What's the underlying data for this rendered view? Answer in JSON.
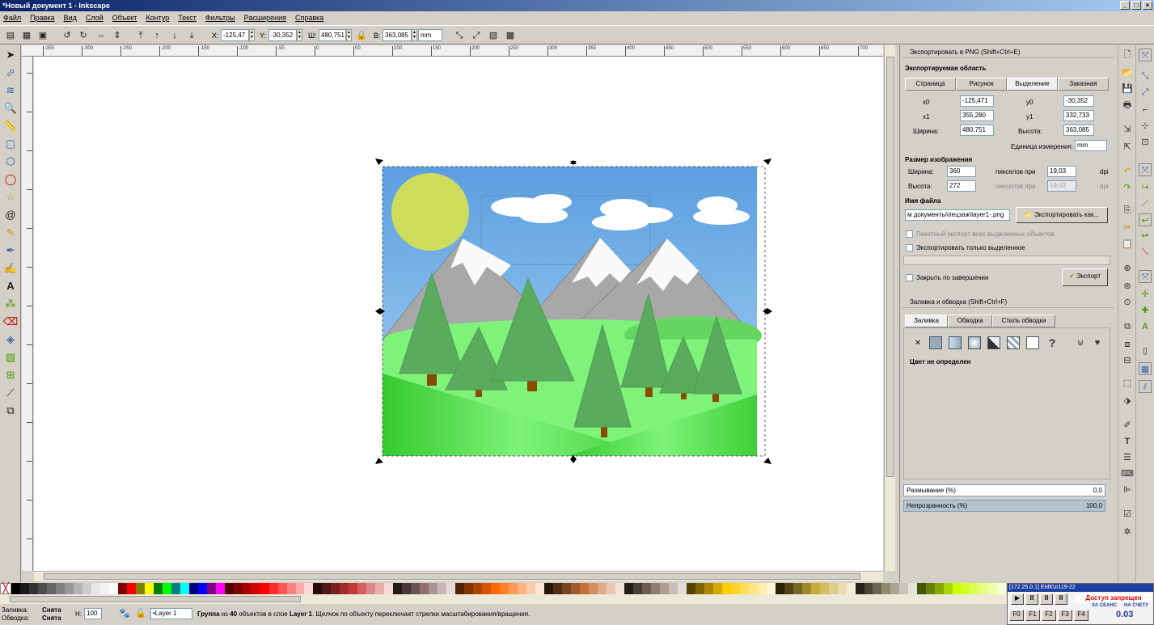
{
  "title": "*Новый документ 1 - Inkscape",
  "window_buttons": [
    "_",
    "□",
    "×"
  ],
  "menu": [
    "Файл",
    "Правка",
    "Вид",
    "Слой",
    "Объект",
    "Контур",
    "Текст",
    "Фильтры",
    "Расширения",
    "Справка"
  ],
  "controls": {
    "x_label": "X:",
    "x": "-125,47",
    "y_label": "Y:",
    "y": "-30,352",
    "w_label": "Ш:",
    "w": "480,751",
    "h_label": "В:",
    "h": "363,085",
    "unit": "mm"
  },
  "ruler_ticks": [
    "-350",
    "-300",
    "-250",
    "-200",
    "-150",
    "-100",
    "-50",
    "0",
    "50",
    "100",
    "150",
    "200",
    "250",
    "300",
    "350",
    "400",
    "450",
    "500",
    "550",
    "600",
    "650",
    "700",
    "750"
  ],
  "export": {
    "title": "Экспортировать в PNG (Shift+Ctrl+E)",
    "area_heading": "Экспортируемая область",
    "tabs": [
      "Страница",
      "Рисунок",
      "Выделение",
      "Заказная"
    ],
    "x0_label": "x0",
    "x0": "-125,471",
    "y0_label": "y0",
    "y0": "-30,352",
    "x1_label": "x1",
    "x1": "355,280",
    "y1_label": "y1",
    "y1": "332,733",
    "width_label": "Ширина:",
    "width": "480,751",
    "height_label": "Высота:",
    "height": "363,085",
    "unit_label": "Единица измерения:",
    "unit": "mm",
    "size_heading": "Размер изображения",
    "px_width_label": "Ширина:",
    "px_width": "360",
    "ppi_label": "пикселов при",
    "dpi": "19,03",
    "dpi_unit": "dpi",
    "px_height_label": "Высота:",
    "px_height": "272",
    "dpi2": "19,03",
    "file_heading": "Имя файла",
    "filename": "м документы\\пецзаж\\layer1-.png",
    "export_as": "Экспортировать как...",
    "batch": "Пакетный экспорт всех выделенных объектов",
    "only_selected": "Экспортировать только выделенное",
    "close_when_done": "Закрыть по завершении",
    "export_btn": "Экспорт"
  },
  "fill": {
    "title": "Заливка и обводка (Shift+Ctrl+F)",
    "tabs": [
      "Заливка",
      "Обводка",
      "Стиль обводки"
    ],
    "undefined": "Цвет не определен",
    "blur_label": "Размывание (%)",
    "blur": "0,0",
    "opacity_label": "Непрозрачность (%)",
    "opacity": "100,0"
  },
  "palette": [
    "#000000",
    "#1a1a1a",
    "#333333",
    "#4d4d4d",
    "#666666",
    "#808080",
    "#999999",
    "#b3b3b3",
    "#cccccc",
    "#e6e6e6",
    "#f2f2f2",
    "#ffffff",
    "#800000",
    "#ff0000",
    "#808000",
    "#ffff00",
    "#008000",
    "#00ff00",
    "#008080",
    "#00ffff",
    "#000080",
    "#0000ff",
    "#800080",
    "#ff00ff",
    "#550000",
    "#800000",
    "#aa0000",
    "#d40000",
    "#ff0000",
    "#ff2a2a",
    "#ff5555",
    "#ff8080",
    "#ffaaaa",
    "#ffd5d5",
    "#280b0b",
    "#501616",
    "#782121",
    "#a02c2c",
    "#c83737",
    "#d35f5f",
    "#de8787",
    "#e9afaf",
    "#f4d7d7",
    "#241c1c",
    "#483737",
    "#6c5353",
    "#916f6f",
    "#ac9393",
    "#c8b7b7",
    "#e3dbdb",
    "#552200",
    "#803300",
    "#aa4400",
    "#d45500",
    "#ff6600",
    "#ff7f2a",
    "#ff9955",
    "#ffb380",
    "#ffccaa",
    "#ffe6d5",
    "#28170b",
    "#502d16",
    "#784421",
    "#a05a2c",
    "#c87137",
    "#d38d5f",
    "#deaa87",
    "#e9c6af",
    "#f4e3d7",
    "#241f1c",
    "#483e37",
    "#6c5d53",
    "#917c6f",
    "#ac9d93",
    "#c8beb7",
    "#e3dedb",
    "#554400",
    "#806600",
    "#aa8800",
    "#d4aa00",
    "#ffcc00",
    "#ffd42a",
    "#ffdd55",
    "#ffe680",
    "#ffeeaa",
    "#fff6d5",
    "#282201",
    "#504416",
    "#786721",
    "#a0892c",
    "#c8ab37",
    "#d3bc5f",
    "#decd87",
    "#e9ddaf",
    "#f4eed7",
    "#24221c",
    "#484537",
    "#6c6753",
    "#918a6f",
    "#aca793",
    "#c8c4b7",
    "#e3e2db",
    "#445500",
    "#668000",
    "#88aa00",
    "#aad400",
    "#ccff00",
    "#d4ff2a",
    "#ddff55",
    "#e5ff80",
    "#eeffaa",
    "#f6ffd5"
  ],
  "status": {
    "fill_label": "Заливка:",
    "fill_val": "Снята",
    "stroke_label": "Обводка:",
    "stroke_val": "Снята",
    "h_label": "Н:",
    "h_val": "100",
    "layer": "•Layer 1",
    "message_bold1": "Группа",
    "message_p1": " из ",
    "message_bold2": "40",
    "message_p2": " объектов в слое ",
    "message_bold3": "Layer 1",
    "message_p3": ". Щелчок по объекту переключает стрелки масштабирования/вращения."
  },
  "kiosk": {
    "ip": "[172.25.0.1] ЕМК\\zi119-22",
    "access": "Доступ запрещен",
    "session": "ЗА СЕАНС",
    "account": "НА СЧЕТУ",
    "amount": "0.03",
    "fkeys": [
      "F0",
      "F1",
      "F2",
      "F3",
      "F4"
    ]
  },
  "colors": {
    "sky": "#6aa8e4",
    "sun": "#cddc5a",
    "grass": "#7ff27a",
    "tree": "#5aab5e",
    "mountain": "#a8a8a8"
  }
}
